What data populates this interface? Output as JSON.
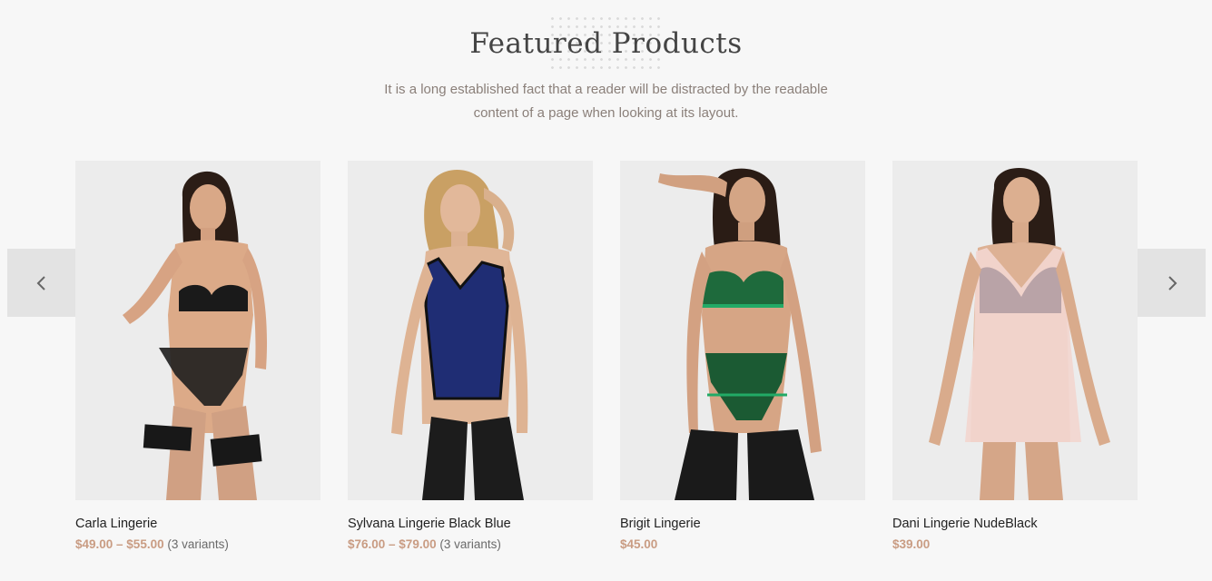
{
  "section": {
    "title": "Featured Products",
    "subtitle": "It is a long established fact that a reader will be distracted by the readable content of a page when looking at its layout."
  },
  "carousel": {
    "prev_icon": "chevron-left-icon",
    "next_icon": "chevron-right-icon"
  },
  "products": [
    {
      "name": "Carla Lingerie",
      "price": "$49.00 – $55.00",
      "variants": "(3 variants)",
      "image": "model-black-lingerie"
    },
    {
      "name": "Sylvana Lingerie Black Blue",
      "price": "$76.00 – $79.00",
      "variants": "(3 variants)",
      "image": "model-blue-bodice"
    },
    {
      "name": "Brigit Lingerie",
      "price": "$45.00",
      "variants": "",
      "image": "model-green-lingerie"
    },
    {
      "name": "Dani Lingerie NudeBlack",
      "price": "$39.00",
      "variants": "",
      "image": "model-nude-chemise"
    }
  ],
  "colors": {
    "price": "#c99c83",
    "background": "#f7f7f7",
    "photo_bg": "#ececec"
  }
}
